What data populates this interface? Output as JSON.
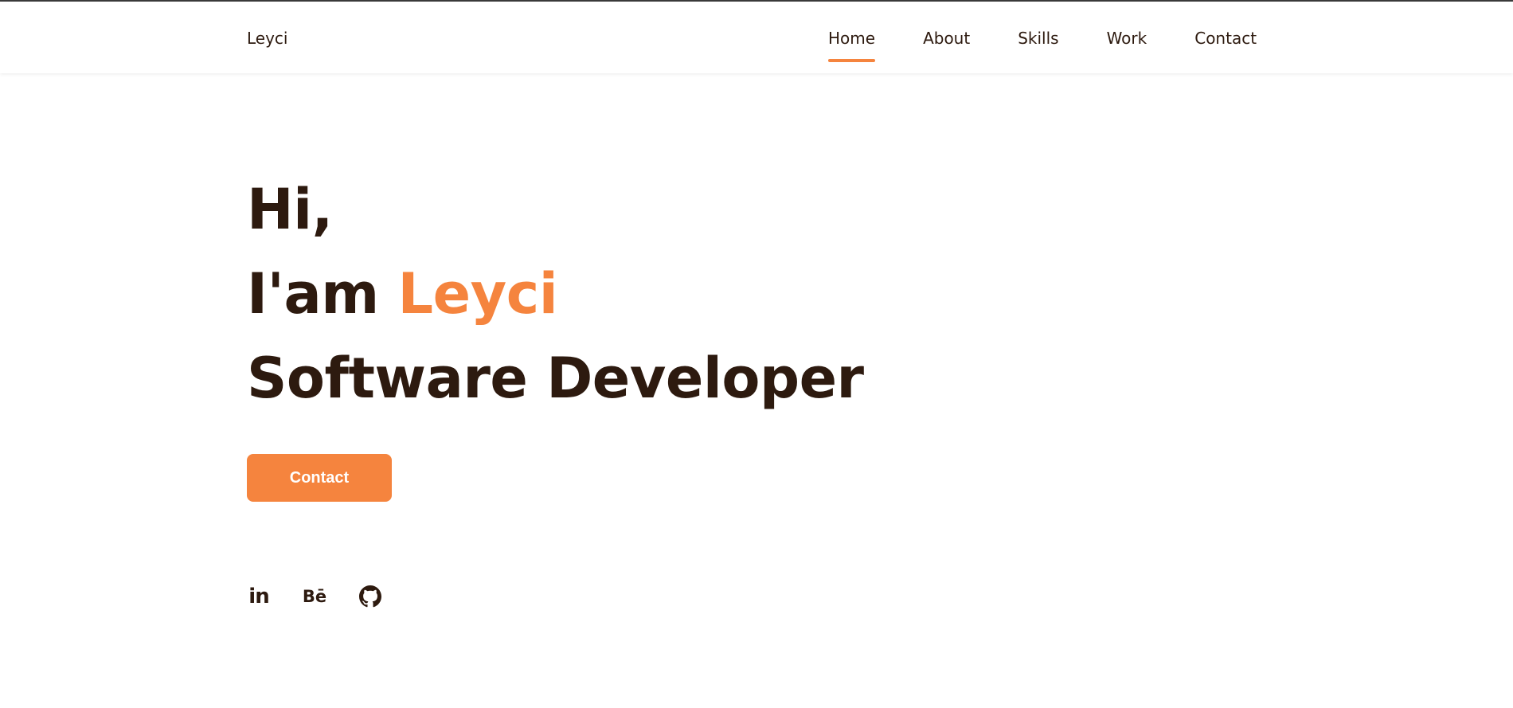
{
  "header": {
    "logo": "Leyci",
    "nav": [
      {
        "label": "Home",
        "active": true
      },
      {
        "label": "About",
        "active": false
      },
      {
        "label": "Skills",
        "active": false
      },
      {
        "label": "Work",
        "active": false
      },
      {
        "label": "Contact",
        "active": false
      }
    ]
  },
  "hero": {
    "greeting": "Hi,",
    "intro_prefix": "I'am",
    "name": "Leyci",
    "role": "Software Developer",
    "contact_button": "Contact"
  },
  "socials": [
    {
      "icon": "linkedin-icon",
      "glyph": "in"
    },
    {
      "icon": "behance-icon",
      "glyph": "Bē"
    },
    {
      "icon": "github-icon"
    }
  ],
  "colors": {
    "accent": "#f5843e",
    "text": "#2d1a0f",
    "background": "#ffffff"
  }
}
